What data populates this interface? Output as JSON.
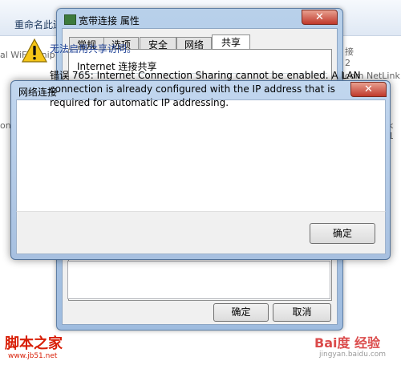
{
  "background": {
    "toolbar_label": "重命名此连",
    "text_left_1": "al WiFi Minip",
    "text_left_2": "on",
    "text_right_1": "接",
    "text_right_2": "2",
    "text_right_3": "dcom NetLink",
    "text_right_4": "k 1"
  },
  "properties_dialog": {
    "title": "宽带连接 属性",
    "close_glyph": "✕",
    "tabs": [
      {
        "label": "常规"
      },
      {
        "label": "选项"
      },
      {
        "label": "安全"
      },
      {
        "label": "网络"
      },
      {
        "label": "共享",
        "active": true
      }
    ],
    "section_title": "Internet 连接共享",
    "ok_label": "确定",
    "cancel_label": "取消"
  },
  "error_dialog": {
    "title": "网络连接",
    "close_glyph": "✕",
    "icon": "warning-icon",
    "heading": "无法启用共享访问。",
    "message": "错误 765: Internet Connection Sharing cannot be enabled.  A LAN connection is already configured with the IP address that is required for automatic IP addressing.",
    "ok_label": "确定"
  },
  "watermarks": {
    "left_brand": "脚本之家",
    "left_url": "www.jb51.net",
    "right_brand": "Bai度 经验",
    "right_url": "jingyan.baidu.com"
  },
  "colors": {
    "warning_yellow": "#f5c518",
    "heading_blue": "#1c3f94",
    "close_red": "#c0392b"
  }
}
